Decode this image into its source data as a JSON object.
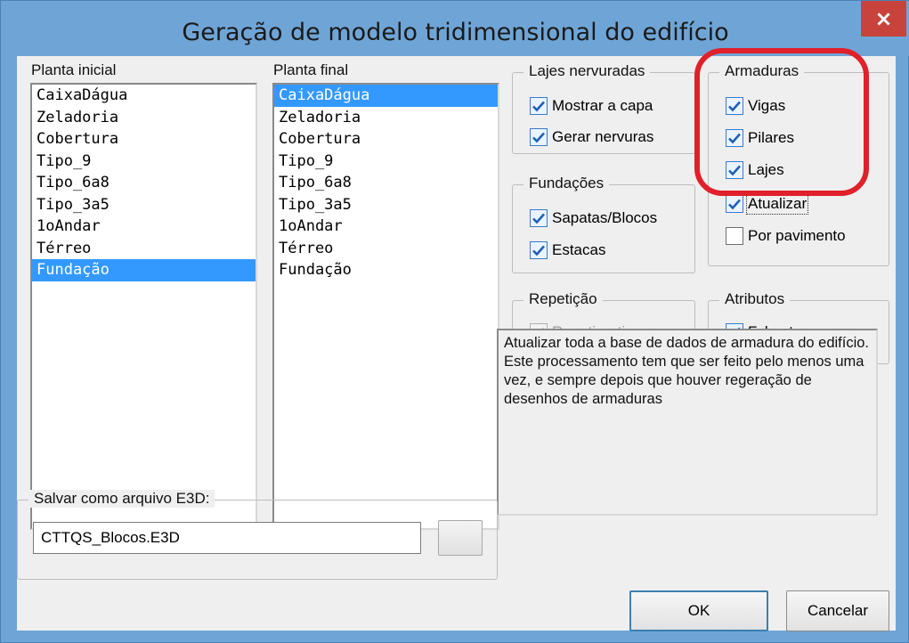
{
  "window": {
    "title": "Geração de modelo tridimensional do edifício",
    "close_label": "×"
  },
  "planta_inicial": {
    "label": "Planta inicial",
    "items": [
      "CaixaDágua",
      "Zeladoria",
      "Cobertura",
      "Tipo_9",
      "Tipo_6a8",
      "Tipo_3a5",
      "1oAndar",
      "Térreo",
      "Fundação"
    ],
    "selected": "Fundação"
  },
  "planta_final": {
    "label": "Planta final",
    "items": [
      "CaixaDágua",
      "Zeladoria",
      "Cobertura",
      "Tipo_9",
      "Tipo_6a8",
      "Tipo_3a5",
      "1oAndar",
      "Térreo",
      "Fundação"
    ],
    "selected": "CaixaDágua"
  },
  "lajes_nervuradas": {
    "title": "Lajes nervuradas",
    "mostrar_capa": {
      "label": "Mostrar a capa",
      "checked": true
    },
    "gerar_nervuras": {
      "label": "Gerar nervuras",
      "checked": true
    }
  },
  "fundacoes": {
    "title": "Fundações",
    "sapatas": {
      "label": "Sapatas/Blocos",
      "checked": true
    },
    "estacas": {
      "label": "Estacas",
      "checked": true
    }
  },
  "armaduras": {
    "title": "Armaduras",
    "vigas": {
      "label": "Vigas",
      "checked": true
    },
    "pilares": {
      "label": "Pilares",
      "checked": true
    },
    "lajes": {
      "label": "Lajes",
      "checked": true
    },
    "atualizar": {
      "label": "Atualizar",
      "checked": true
    },
    "por_pavimento": {
      "label": "Por pavimento",
      "checked": false
    }
  },
  "repeticao": {
    "title": "Repetição",
    "repetir": {
      "label": "Repetir o tipo",
      "checked": true,
      "disabled": true
    }
  },
  "atributos": {
    "title": "Atributos",
    "fck": {
      "label": "Fck e taxas",
      "checked": true
    }
  },
  "description": "Atualizar toda a base de dados de armadura do edifício. Este processamento tem que ser feito pelo menos uma vez, e sempre depois que houver regeração de desenhos de armaduras",
  "save": {
    "title": "Salvar como arquivo E3D:",
    "filename": "CTTQS_Blocos.E3D"
  },
  "buttons": {
    "ok": "OK",
    "cancel": "Cancelar"
  },
  "colors": {
    "title_bar": "#6fa5d6",
    "close_button": "#c7433c",
    "selection": "#3399ff",
    "annotation_ring": "#e0202a"
  }
}
